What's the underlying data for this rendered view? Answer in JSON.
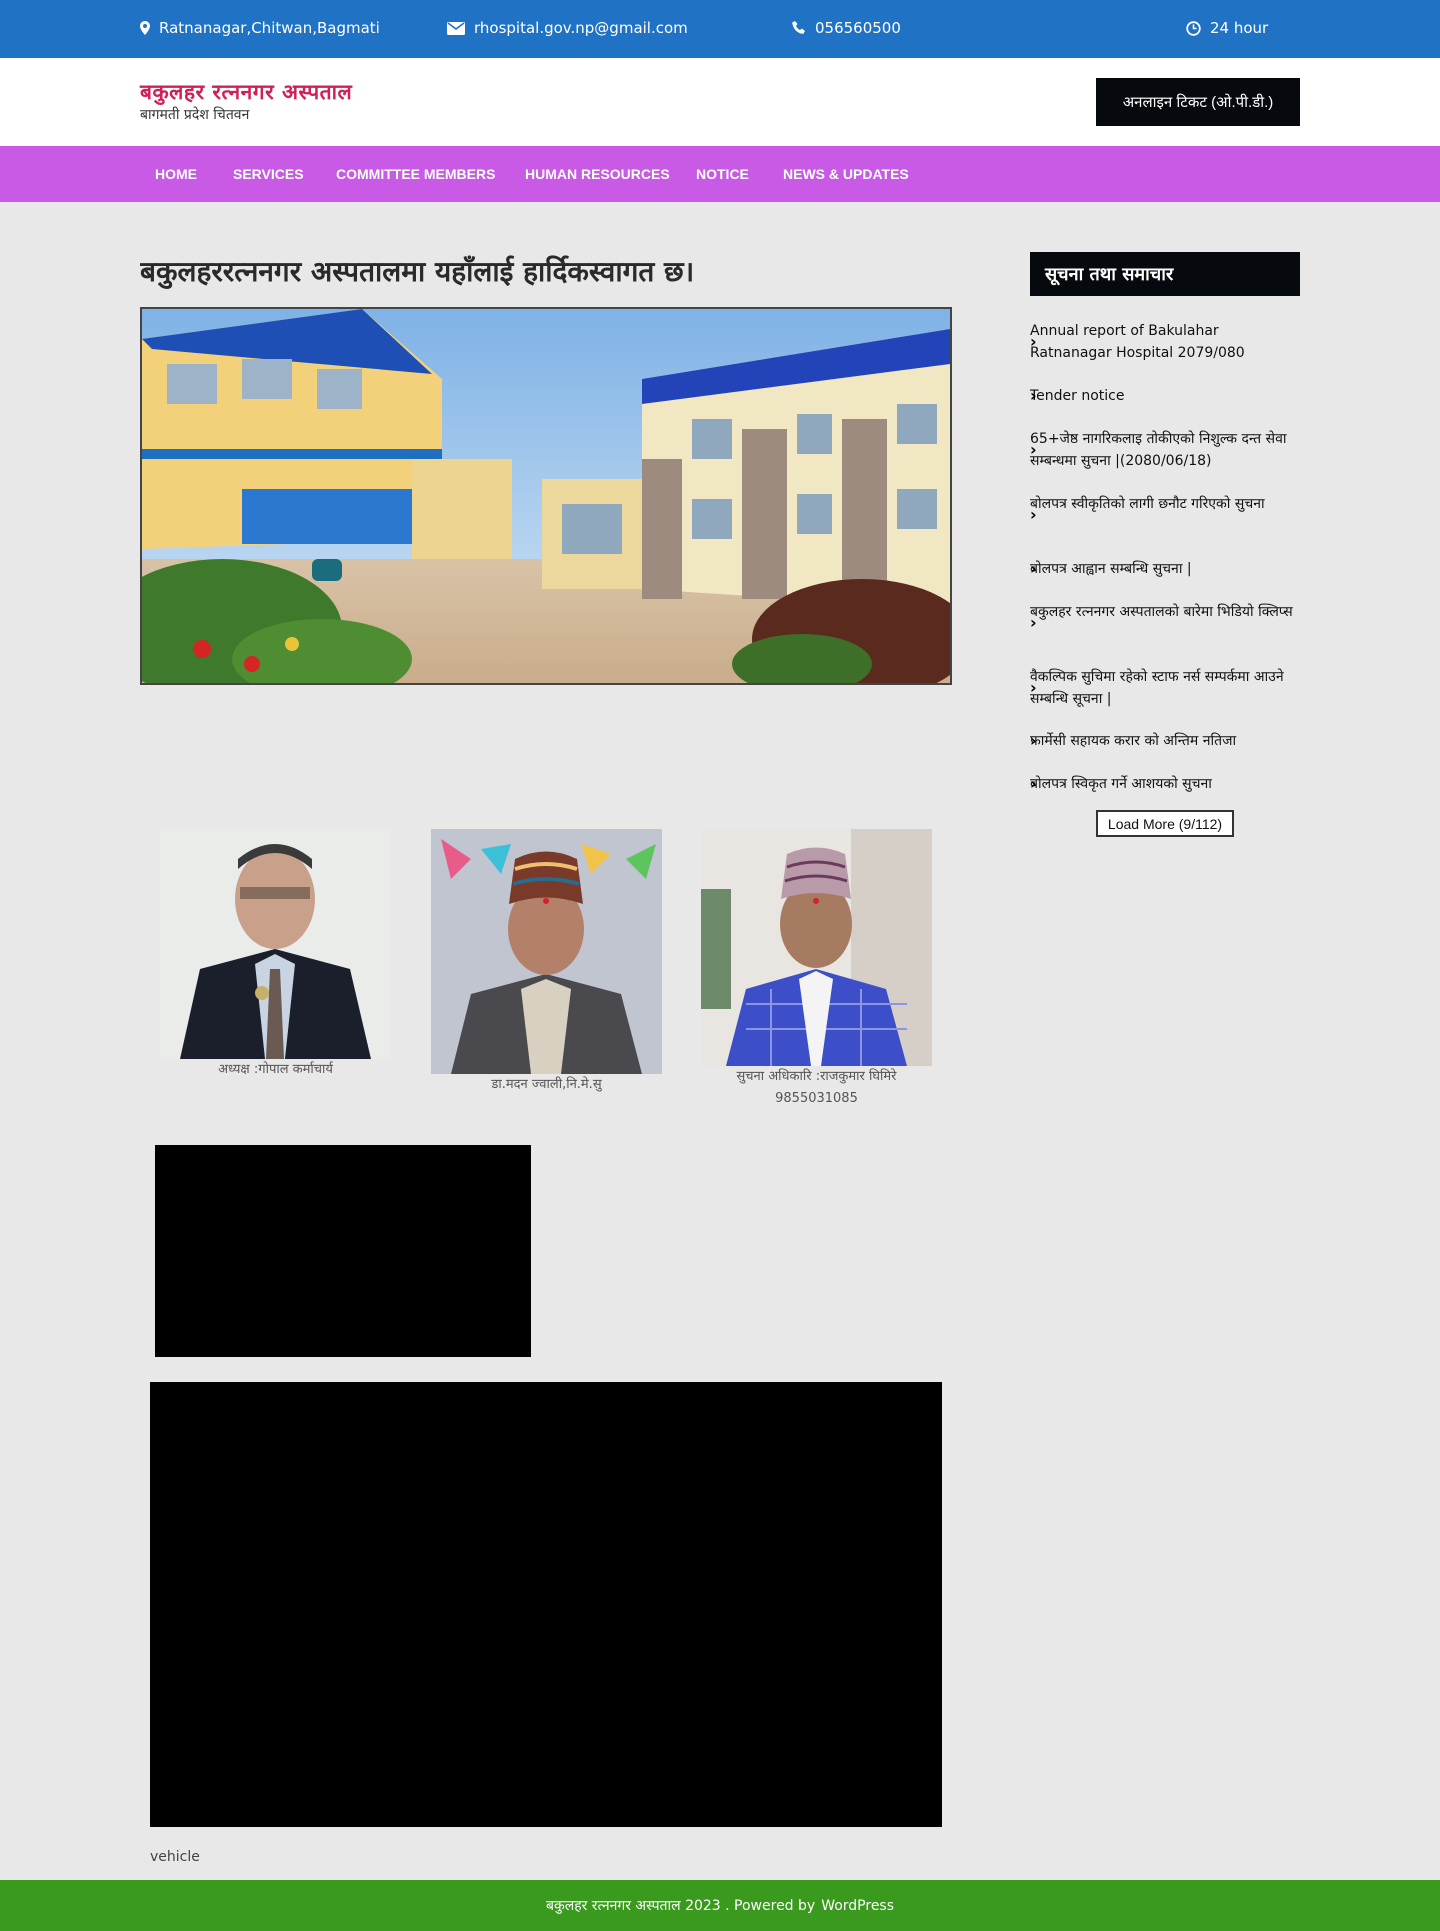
{
  "topbar": {
    "address": "Ratnanagar,Chitwan,Bagmati",
    "email": "rhospital.gov.np@gmail.com",
    "phone": "056560500",
    "hours": "24 hour",
    "icons": [
      "map-pin-icon",
      "envelope-icon",
      "phone-icon",
      "clock-icon"
    ]
  },
  "header": {
    "site_title": "बकुलहर रत्ननगर अस्पताल",
    "tagline": "बागमती प्रदेश चितवन",
    "ticket_button": "अनलाइन टिकट (ओ.पी.डी.)"
  },
  "nav": {
    "items": [
      "HOME",
      "SERVICES",
      "COMMITTEE MEMBERS",
      "HUMAN RESOURCES",
      "NOTICE",
      "NEWS & UPDATES"
    ],
    "color": "#c95ae6"
  },
  "main": {
    "heading": "बकुलहररत्ननगर अस्पतालमा यहाँलाई हार्दिकस्वागत छ।"
  },
  "people": [
    {
      "caption": "अध्यक्ष :गोपाल कर्माचार्य"
    },
    {
      "caption": "डा.मदन ज्वाली,नि.मे.सु"
    },
    {
      "caption": "सुचना अधिकारि :राजकुमार घिमिरे",
      "phone": "9855031085"
    }
  ],
  "video": {
    "caption": "vehicle"
  },
  "sidebar": {
    "title": "सूचना तथा समाचार",
    "notices": [
      "Annual report of Bakulahar Ratnanagar Hospital 2079/080",
      "Tender notice",
      "65+जेष्ठ नागरिकलाइ तोकीएको निशुल्क दन्त सेवा सम्बन्धमा सुचना |(2080/06/18)",
      "बोलपत्र स्वीकृतिको लागी छनौट गरिएको सुचना",
      "बोलपत्र आह्वान सम्बन्धि सुचना |",
      "बकुलहर रत्ननगर अस्पतालको बारेमा भिडियो क्लिप्स",
      "वैकल्पिक सुचिमा रहेको स्टाफ नर्स सम्पर्कमा आउने सम्बन्धि सूचना |",
      "फार्मेसी सहायक करार को अन्तिम नतिजा",
      "बोलपत्र स्विकृत गर्ने आशयको सुचना"
    ],
    "load_more": "Load More (9/112)"
  },
  "footer": {
    "text": "बकुलहर रत्ननगर अस्पताल 2023 . Powered by",
    "link": "WordPress",
    "color": "#3a9a1e"
  },
  "colors": {
    "topbar": "#1f72c4",
    "title": "#d11f57",
    "dark": "#060a0e",
    "background": "#e8e8e8"
  }
}
